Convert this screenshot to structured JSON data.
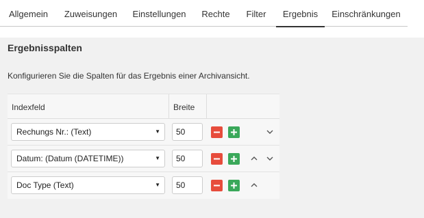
{
  "tabs": [
    {
      "label": "Allgemein"
    },
    {
      "label": "Zuweisungen"
    },
    {
      "label": "Einstellungen"
    },
    {
      "label": "Rechte"
    },
    {
      "label": "Filter"
    },
    {
      "label": "Ergebnis",
      "active": true
    },
    {
      "label": "Einschränkungen"
    }
  ],
  "section": {
    "title": "Ergebnisspalten",
    "description": "Konfigurieren Sie die Spalten für das Ergebnis einer Archivansicht."
  },
  "grid": {
    "headers": {
      "index_field": "Indexfeld",
      "width": "Breite"
    },
    "rows": [
      {
        "field": "Rechungs Nr.: (Text)",
        "width": "50",
        "move_up": false,
        "move_down": true
      },
      {
        "field": "Datum: (Datum (DATETIME))",
        "width": "50",
        "move_up": true,
        "move_down": true
      },
      {
        "field": "Doc Type (Text)",
        "width": "50",
        "move_up": true,
        "move_down": false
      }
    ]
  },
  "icons": {
    "remove": "minus-icon",
    "add": "plus-icon",
    "up": "chevron-up-icon",
    "down": "chevron-down-icon",
    "dropdown": "caret-down-icon"
  },
  "colors": {
    "remove_button": "#e74c3c",
    "add_button": "#3aa85a",
    "panel_background": "#f1f1f1",
    "active_tab_underline": "#333333"
  }
}
